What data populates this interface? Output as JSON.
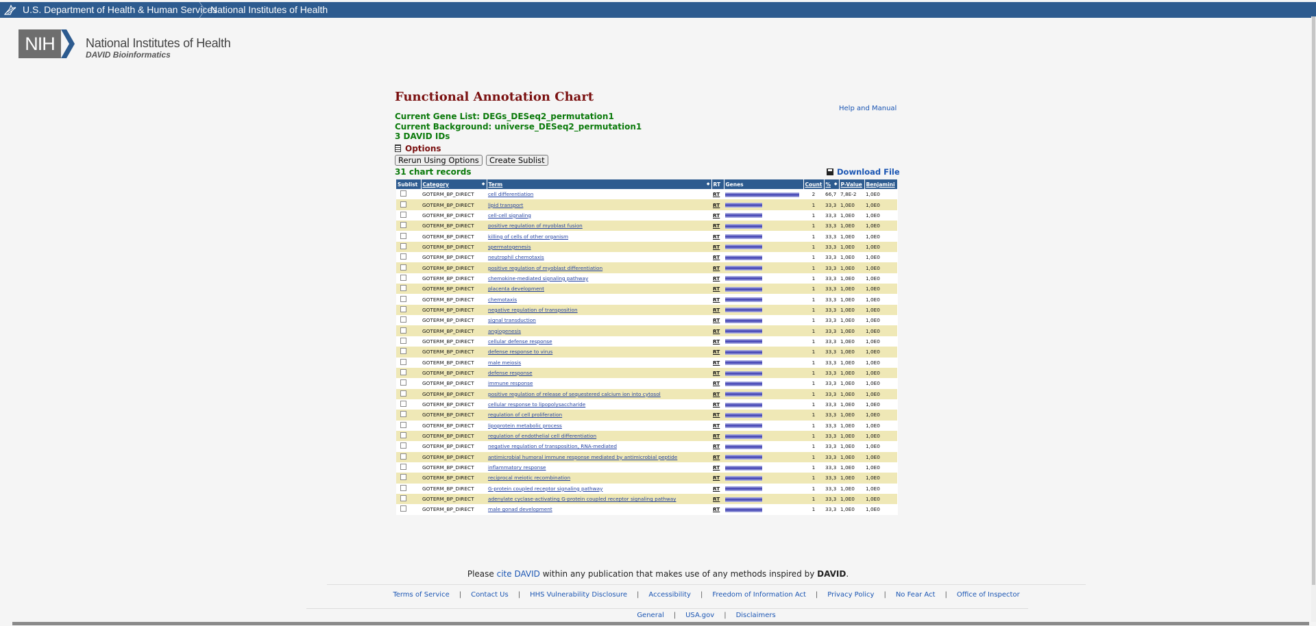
{
  "header": {
    "hhs_link": "U.S. Department of Health & Human Services",
    "nih_link": "National Institutes of Health"
  },
  "logo": {
    "mark": "NIH",
    "name": "National Institutes of Health",
    "subtitle": "DAVID Bioinformatics"
  },
  "page": {
    "title": "Functional Annotation Chart",
    "help_link": "Help and Manual",
    "gene_list": "Current Gene List: DEGs_DESeq2_permutation1",
    "background": "Current Background: universe_DESeq2_permutation1",
    "ids": "3 DAVID IDs",
    "options": "Options",
    "rerun_button": "Rerun Using Options",
    "sublist_button": "Create Sublist",
    "records": "31 chart records",
    "download": "Download File"
  },
  "table": {
    "headers": {
      "sublist": "Sublist",
      "category": "Category",
      "term": "Term",
      "rt": "RT",
      "genes": "Genes",
      "count": "Count",
      "percent": "%",
      "pvalue": "P-Value",
      "benjamini": "Benjamini"
    },
    "rows": [
      {
        "category": "GOTERM_BP_DIRECT",
        "term": "cell differentiation",
        "rt": "RT",
        "genes_fraction": 1.0,
        "count": "2",
        "percent": "66,7",
        "pvalue": "7,8E-2",
        "benjamini": "1,0E0"
      },
      {
        "category": "GOTERM_BP_DIRECT",
        "term": "lipid transport",
        "rt": "RT",
        "genes_fraction": 0.5,
        "count": "1",
        "percent": "33,3",
        "pvalue": "1,0E0",
        "benjamini": "1,0E0"
      },
      {
        "category": "GOTERM_BP_DIRECT",
        "term": "cell-cell signaling",
        "rt": "RT",
        "genes_fraction": 0.5,
        "count": "1",
        "percent": "33,3",
        "pvalue": "1,0E0",
        "benjamini": "1,0E0"
      },
      {
        "category": "GOTERM_BP_DIRECT",
        "term": "positive regulation of myoblast fusion",
        "rt": "RT",
        "genes_fraction": 0.5,
        "count": "1",
        "percent": "33,3",
        "pvalue": "1,0E0",
        "benjamini": "1,0E0"
      },
      {
        "category": "GOTERM_BP_DIRECT",
        "term": "killing of cells of other organism",
        "rt": "RT",
        "genes_fraction": 0.5,
        "count": "1",
        "percent": "33,3",
        "pvalue": "1,0E0",
        "benjamini": "1,0E0"
      },
      {
        "category": "GOTERM_BP_DIRECT",
        "term": "spermatogenesis",
        "rt": "RT",
        "genes_fraction": 0.5,
        "count": "1",
        "percent": "33,3",
        "pvalue": "1,0E0",
        "benjamini": "1,0E0"
      },
      {
        "category": "GOTERM_BP_DIRECT",
        "term": "neutrophil chemotaxis",
        "rt": "RT",
        "genes_fraction": 0.5,
        "count": "1",
        "percent": "33,3",
        "pvalue": "1,0E0",
        "benjamini": "1,0E0"
      },
      {
        "category": "GOTERM_BP_DIRECT",
        "term": "positive regulation of myoblast differentiation",
        "rt": "RT",
        "genes_fraction": 0.5,
        "count": "1",
        "percent": "33,3",
        "pvalue": "1,0E0",
        "benjamini": "1,0E0"
      },
      {
        "category": "GOTERM_BP_DIRECT",
        "term": "chemokine-mediated signaling pathway",
        "rt": "RT",
        "genes_fraction": 0.5,
        "count": "1",
        "percent": "33,3",
        "pvalue": "1,0E0",
        "benjamini": "1,0E0"
      },
      {
        "category": "GOTERM_BP_DIRECT",
        "term": "placenta development",
        "rt": "RT",
        "genes_fraction": 0.5,
        "count": "1",
        "percent": "33,3",
        "pvalue": "1,0E0",
        "benjamini": "1,0E0"
      },
      {
        "category": "GOTERM_BP_DIRECT",
        "term": "chemotaxis",
        "rt": "RT",
        "genes_fraction": 0.5,
        "count": "1",
        "percent": "33,3",
        "pvalue": "1,0E0",
        "benjamini": "1,0E0"
      },
      {
        "category": "GOTERM_BP_DIRECT",
        "term": "negative regulation of transposition",
        "rt": "RT",
        "genes_fraction": 0.5,
        "count": "1",
        "percent": "33,3",
        "pvalue": "1,0E0",
        "benjamini": "1,0E0"
      },
      {
        "category": "GOTERM_BP_DIRECT",
        "term": "signal transduction",
        "rt": "RT",
        "genes_fraction": 0.5,
        "count": "1",
        "percent": "33,3",
        "pvalue": "1,0E0",
        "benjamini": "1,0E0"
      },
      {
        "category": "GOTERM_BP_DIRECT",
        "term": "angiogenesis",
        "rt": "RT",
        "genes_fraction": 0.5,
        "count": "1",
        "percent": "33,3",
        "pvalue": "1,0E0",
        "benjamini": "1,0E0"
      },
      {
        "category": "GOTERM_BP_DIRECT",
        "term": "cellular defense response",
        "rt": "RT",
        "genes_fraction": 0.5,
        "count": "1",
        "percent": "33,3",
        "pvalue": "1,0E0",
        "benjamini": "1,0E0"
      },
      {
        "category": "GOTERM_BP_DIRECT",
        "term": "defense response to virus",
        "rt": "RT",
        "genes_fraction": 0.5,
        "count": "1",
        "percent": "33,3",
        "pvalue": "1,0E0",
        "benjamini": "1,0E0"
      },
      {
        "category": "GOTERM_BP_DIRECT",
        "term": "male meiosis",
        "rt": "RT",
        "genes_fraction": 0.5,
        "count": "1",
        "percent": "33,3",
        "pvalue": "1,0E0",
        "benjamini": "1,0E0"
      },
      {
        "category": "GOTERM_BP_DIRECT",
        "term": "defense response",
        "rt": "RT",
        "genes_fraction": 0.5,
        "count": "1",
        "percent": "33,3",
        "pvalue": "1,0E0",
        "benjamini": "1,0E0"
      },
      {
        "category": "GOTERM_BP_DIRECT",
        "term": "immune response",
        "rt": "RT",
        "genes_fraction": 0.5,
        "count": "1",
        "percent": "33,3",
        "pvalue": "1,0E0",
        "benjamini": "1,0E0"
      },
      {
        "category": "GOTERM_BP_DIRECT",
        "term": "positive regulation of release of sequestered calcium ion into cytosol",
        "rt": "RT",
        "genes_fraction": 0.5,
        "count": "1",
        "percent": "33,3",
        "pvalue": "1,0E0",
        "benjamini": "1,0E0"
      },
      {
        "category": "GOTERM_BP_DIRECT",
        "term": "cellular response to lipopolysaccharide",
        "rt": "RT",
        "genes_fraction": 0.5,
        "count": "1",
        "percent": "33,3",
        "pvalue": "1,0E0",
        "benjamini": "1,0E0"
      },
      {
        "category": "GOTERM_BP_DIRECT",
        "term": "regulation of cell proliferation",
        "rt": "RT",
        "genes_fraction": 0.5,
        "count": "1",
        "percent": "33,3",
        "pvalue": "1,0E0",
        "benjamini": "1,0E0"
      },
      {
        "category": "GOTERM_BP_DIRECT",
        "term": "lipoprotein metabolic process",
        "rt": "RT",
        "genes_fraction": 0.5,
        "count": "1",
        "percent": "33,3",
        "pvalue": "1,0E0",
        "benjamini": "1,0E0"
      },
      {
        "category": "GOTERM_BP_DIRECT",
        "term": "regulation of endothelial cell differentiation",
        "rt": "RT",
        "genes_fraction": 0.5,
        "count": "1",
        "percent": "33,3",
        "pvalue": "1,0E0",
        "benjamini": "1,0E0"
      },
      {
        "category": "GOTERM_BP_DIRECT",
        "term": "negative regulation of transposition, RNA-mediated",
        "rt": "RT",
        "genes_fraction": 0.5,
        "count": "1",
        "percent": "33,3",
        "pvalue": "1,0E0",
        "benjamini": "1,0E0"
      },
      {
        "category": "GOTERM_BP_DIRECT",
        "term": "antimicrobial humoral immune response mediated by antimicrobial peptide",
        "rt": "RT",
        "genes_fraction": 0.5,
        "count": "1",
        "percent": "33,3",
        "pvalue": "1,0E0",
        "benjamini": "1,0E0"
      },
      {
        "category": "GOTERM_BP_DIRECT",
        "term": "inflammatory response",
        "rt": "RT",
        "genes_fraction": 0.5,
        "count": "1",
        "percent": "33,3",
        "pvalue": "1,0E0",
        "benjamini": "1,0E0"
      },
      {
        "category": "GOTERM_BP_DIRECT",
        "term": "reciprocal meiotic recombination",
        "rt": "RT",
        "genes_fraction": 0.5,
        "count": "1",
        "percent": "33,3",
        "pvalue": "1,0E0",
        "benjamini": "1,0E0"
      },
      {
        "category": "GOTERM_BP_DIRECT",
        "term": "G-protein coupled receptor signaling pathway",
        "rt": "RT",
        "genes_fraction": 0.5,
        "count": "1",
        "percent": "33,3",
        "pvalue": "1,0E0",
        "benjamini": "1,0E0"
      },
      {
        "category": "GOTERM_BP_DIRECT",
        "term": "adenylate cyclase-activating G-protein coupled receptor signaling pathway",
        "rt": "RT",
        "genes_fraction": 0.5,
        "count": "1",
        "percent": "33,3",
        "pvalue": "1,0E0",
        "benjamini": "1,0E0"
      },
      {
        "category": "GOTERM_BP_DIRECT",
        "term": "male gonad development",
        "rt": "RT",
        "genes_fraction": 0.5,
        "count": "1",
        "percent": "33,3",
        "pvalue": "1,0E0",
        "benjamini": "1,0E0"
      }
    ]
  },
  "footer": {
    "cite_prefix": "Please",
    "cite_link": "cite DAVID",
    "cite_middle": "within any publication that makes use of any methods inspired by",
    "cite_brand": "DAVID",
    "cite_suffix": ".",
    "links": [
      "Terms of Service",
      "Contact Us",
      "HHS Vulnerability Disclosure",
      "Accessibility",
      "Freedom of Information Act",
      "Privacy Policy",
      "No Fear Act",
      "Office of Inspector General",
      "USA.gov",
      "Disclaimers"
    ]
  },
  "colors": {
    "header_bar": "#2d5b8f",
    "title": "#7a1010",
    "info_green": "#0b7a0b",
    "row_highlight": "#efe8b6",
    "link": "#1a55b3"
  },
  "icons": [
    "eagle-icon",
    "chevron-icon",
    "options-icon",
    "disk-icon",
    "sort-icon"
  ]
}
